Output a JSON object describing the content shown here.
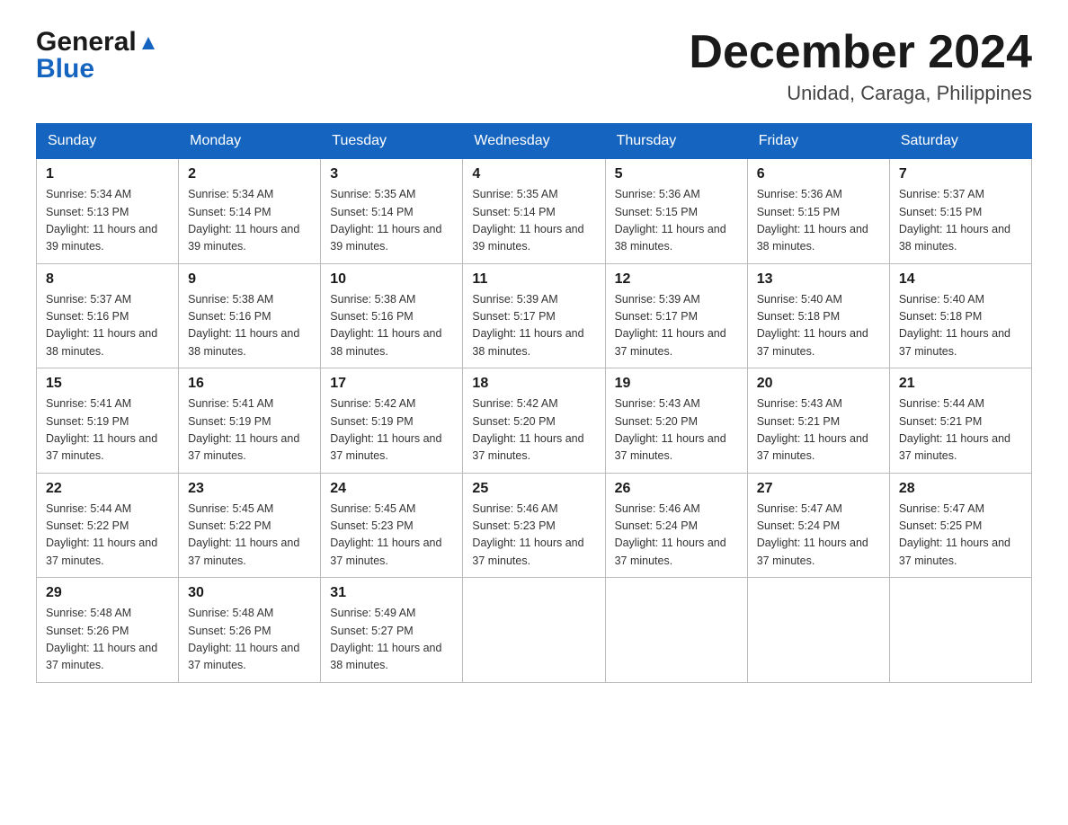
{
  "header": {
    "logo_general": "General",
    "logo_blue": "Blue",
    "month_title": "December 2024",
    "location": "Unidad, Caraga, Philippines"
  },
  "days_of_week": [
    "Sunday",
    "Monday",
    "Tuesday",
    "Wednesday",
    "Thursday",
    "Friday",
    "Saturday"
  ],
  "weeks": [
    [
      {
        "day": "1",
        "sunrise": "5:34 AM",
        "sunset": "5:13 PM",
        "daylight": "11 hours and 39 minutes."
      },
      {
        "day": "2",
        "sunrise": "5:34 AM",
        "sunset": "5:14 PM",
        "daylight": "11 hours and 39 minutes."
      },
      {
        "day": "3",
        "sunrise": "5:35 AM",
        "sunset": "5:14 PM",
        "daylight": "11 hours and 39 minutes."
      },
      {
        "day": "4",
        "sunrise": "5:35 AM",
        "sunset": "5:14 PM",
        "daylight": "11 hours and 39 minutes."
      },
      {
        "day": "5",
        "sunrise": "5:36 AM",
        "sunset": "5:15 PM",
        "daylight": "11 hours and 38 minutes."
      },
      {
        "day": "6",
        "sunrise": "5:36 AM",
        "sunset": "5:15 PM",
        "daylight": "11 hours and 38 minutes."
      },
      {
        "day": "7",
        "sunrise": "5:37 AM",
        "sunset": "5:15 PM",
        "daylight": "11 hours and 38 minutes."
      }
    ],
    [
      {
        "day": "8",
        "sunrise": "5:37 AM",
        "sunset": "5:16 PM",
        "daylight": "11 hours and 38 minutes."
      },
      {
        "day": "9",
        "sunrise": "5:38 AM",
        "sunset": "5:16 PM",
        "daylight": "11 hours and 38 minutes."
      },
      {
        "day": "10",
        "sunrise": "5:38 AM",
        "sunset": "5:16 PM",
        "daylight": "11 hours and 38 minutes."
      },
      {
        "day": "11",
        "sunrise": "5:39 AM",
        "sunset": "5:17 PM",
        "daylight": "11 hours and 38 minutes."
      },
      {
        "day": "12",
        "sunrise": "5:39 AM",
        "sunset": "5:17 PM",
        "daylight": "11 hours and 37 minutes."
      },
      {
        "day": "13",
        "sunrise": "5:40 AM",
        "sunset": "5:18 PM",
        "daylight": "11 hours and 37 minutes."
      },
      {
        "day": "14",
        "sunrise": "5:40 AM",
        "sunset": "5:18 PM",
        "daylight": "11 hours and 37 minutes."
      }
    ],
    [
      {
        "day": "15",
        "sunrise": "5:41 AM",
        "sunset": "5:19 PM",
        "daylight": "11 hours and 37 minutes."
      },
      {
        "day": "16",
        "sunrise": "5:41 AM",
        "sunset": "5:19 PM",
        "daylight": "11 hours and 37 minutes."
      },
      {
        "day": "17",
        "sunrise": "5:42 AM",
        "sunset": "5:19 PM",
        "daylight": "11 hours and 37 minutes."
      },
      {
        "day": "18",
        "sunrise": "5:42 AM",
        "sunset": "5:20 PM",
        "daylight": "11 hours and 37 minutes."
      },
      {
        "day": "19",
        "sunrise": "5:43 AM",
        "sunset": "5:20 PM",
        "daylight": "11 hours and 37 minutes."
      },
      {
        "day": "20",
        "sunrise": "5:43 AM",
        "sunset": "5:21 PM",
        "daylight": "11 hours and 37 minutes."
      },
      {
        "day": "21",
        "sunrise": "5:44 AM",
        "sunset": "5:21 PM",
        "daylight": "11 hours and 37 minutes."
      }
    ],
    [
      {
        "day": "22",
        "sunrise": "5:44 AM",
        "sunset": "5:22 PM",
        "daylight": "11 hours and 37 minutes."
      },
      {
        "day": "23",
        "sunrise": "5:45 AM",
        "sunset": "5:22 PM",
        "daylight": "11 hours and 37 minutes."
      },
      {
        "day": "24",
        "sunrise": "5:45 AM",
        "sunset": "5:23 PM",
        "daylight": "11 hours and 37 minutes."
      },
      {
        "day": "25",
        "sunrise": "5:46 AM",
        "sunset": "5:23 PM",
        "daylight": "11 hours and 37 minutes."
      },
      {
        "day": "26",
        "sunrise": "5:46 AM",
        "sunset": "5:24 PM",
        "daylight": "11 hours and 37 minutes."
      },
      {
        "day": "27",
        "sunrise": "5:47 AM",
        "sunset": "5:24 PM",
        "daylight": "11 hours and 37 minutes."
      },
      {
        "day": "28",
        "sunrise": "5:47 AM",
        "sunset": "5:25 PM",
        "daylight": "11 hours and 37 minutes."
      }
    ],
    [
      {
        "day": "29",
        "sunrise": "5:48 AM",
        "sunset": "5:26 PM",
        "daylight": "11 hours and 37 minutes."
      },
      {
        "day": "30",
        "sunrise": "5:48 AM",
        "sunset": "5:26 PM",
        "daylight": "11 hours and 37 minutes."
      },
      {
        "day": "31",
        "sunrise": "5:49 AM",
        "sunset": "5:27 PM",
        "daylight": "11 hours and 38 minutes."
      },
      null,
      null,
      null,
      null
    ]
  ]
}
